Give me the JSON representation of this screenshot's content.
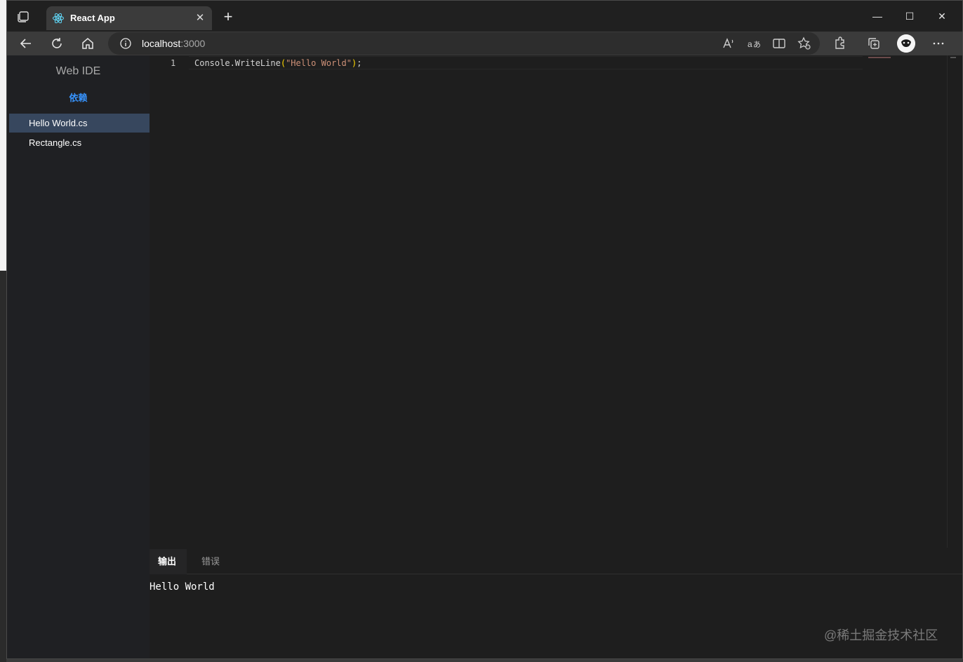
{
  "browser": {
    "tab_title": "React App",
    "url_host": "localhost",
    "url_port": ":3000"
  },
  "sidebar": {
    "brand": "Web IDE",
    "deps_link": "依赖",
    "files": [
      {
        "label": "Hello World.cs",
        "active": true
      },
      {
        "label": "Rectangle.cs",
        "active": false
      }
    ]
  },
  "editor": {
    "line_number": "1",
    "code_prefix": "Console.WriteLine",
    "code_open": "(",
    "code_string": "\"Hello World\"",
    "code_close": ")",
    "code_end": ";"
  },
  "panel": {
    "tabs": [
      "输出",
      "错误"
    ],
    "output_text": "Hello World"
  },
  "watermark": "@稀土掘金技术社区",
  "colors": {
    "accent": "#3794ff",
    "active_file_bg": "#37475e",
    "string": "#ce9178"
  }
}
